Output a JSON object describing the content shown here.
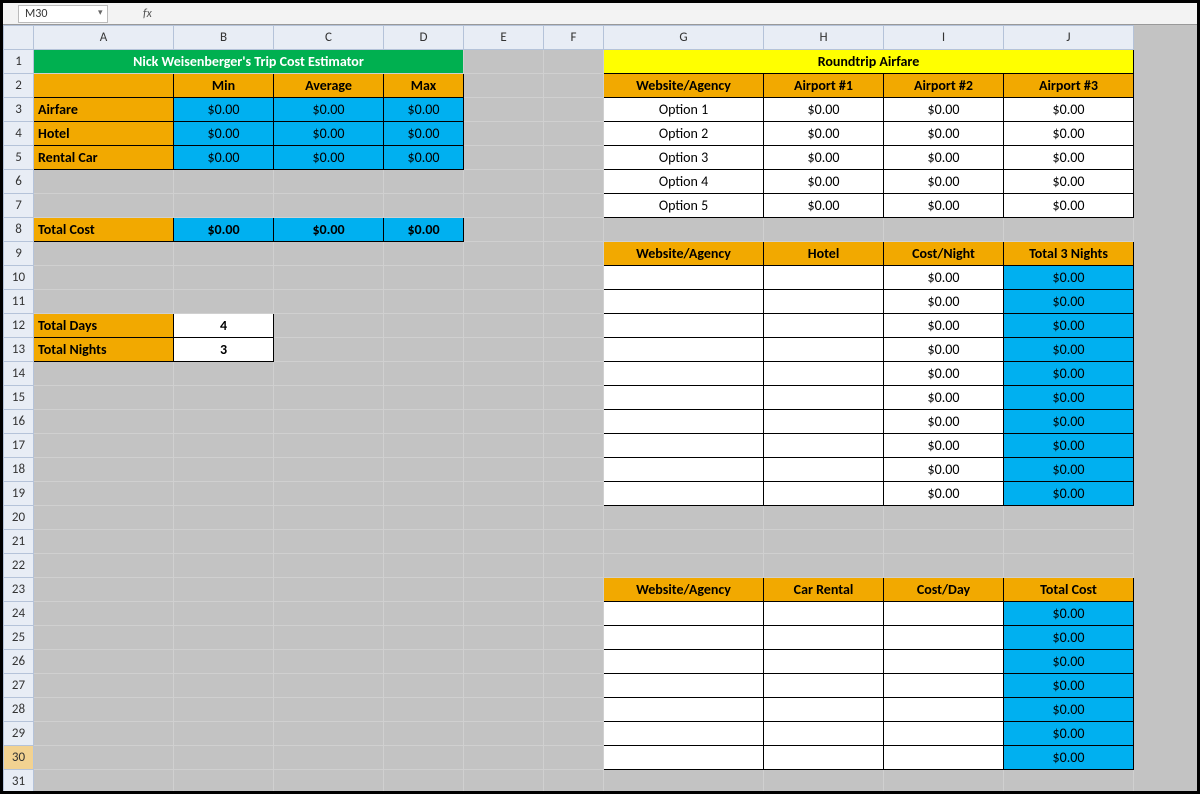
{
  "namebox": "M30",
  "fx_label": "fx",
  "columns": [
    "A",
    "B",
    "C",
    "D",
    "E",
    "F",
    "G",
    "H",
    "I",
    "J"
  ],
  "rows": [
    "1",
    "2",
    "3",
    "4",
    "5",
    "6",
    "7",
    "8",
    "9",
    "10",
    "11",
    "12",
    "13",
    "14",
    "15",
    "16",
    "17",
    "18",
    "19",
    "20",
    "21",
    "22",
    "23",
    "24",
    "25",
    "26",
    "27",
    "28",
    "29",
    "30",
    "31"
  ],
  "left": {
    "title": "Nick Weisenberger's Trip Cost Estimator",
    "headers": {
      "min": "Min",
      "avg": "Average",
      "max": "Max"
    },
    "rows": {
      "airfare": {
        "label": "Airfare",
        "min": "$0.00",
        "avg": "$0.00",
        "max": "$0.00"
      },
      "hotel": {
        "label": "Hotel",
        "min": "$0.00",
        "avg": "$0.00",
        "max": "$0.00"
      },
      "rental": {
        "label": "Rental Car",
        "min": "$0.00",
        "avg": "$0.00",
        "max": "$0.00"
      }
    },
    "total": {
      "label": "Total Cost",
      "min": "$0.00",
      "avg": "$0.00",
      "max": "$0.00"
    },
    "days": {
      "label": "Total Days",
      "value": "4"
    },
    "nights": {
      "label": "Total Nights",
      "value": "3"
    }
  },
  "airfare": {
    "title": "Roundtrip Airfare",
    "headers": {
      "site": "Website/Agency",
      "a1": "Airport #1",
      "a2": "Airport #2",
      "a3": "Airport #3"
    },
    "rows": [
      {
        "site": "Option 1",
        "a1": "$0.00",
        "a2": "$0.00",
        "a3": "$0.00"
      },
      {
        "site": "Option 2",
        "a1": "$0.00",
        "a2": "$0.00",
        "a3": "$0.00"
      },
      {
        "site": "Option 3",
        "a1": "$0.00",
        "a2": "$0.00",
        "a3": "$0.00"
      },
      {
        "site": "Option 4",
        "a1": "$0.00",
        "a2": "$0.00",
        "a3": "$0.00"
      },
      {
        "site": "Option 5",
        "a1": "$0.00",
        "a2": "$0.00",
        "a3": "$0.00"
      }
    ]
  },
  "lodging": {
    "headers": {
      "site": "Website/Agency",
      "hotel": "Hotel",
      "costnight": "Cost/Night",
      "total": "Total 3 Nights"
    },
    "rows": [
      {
        "cost": "$0.00",
        "total": "$0.00"
      },
      {
        "cost": "$0.00",
        "total": "$0.00"
      },
      {
        "cost": "$0.00",
        "total": "$0.00"
      },
      {
        "cost": "$0.00",
        "total": "$0.00"
      },
      {
        "cost": "$0.00",
        "total": "$0.00"
      },
      {
        "cost": "$0.00",
        "total": "$0.00"
      },
      {
        "cost": "$0.00",
        "total": "$0.00"
      },
      {
        "cost": "$0.00",
        "total": "$0.00"
      },
      {
        "cost": "$0.00",
        "total": "$0.00"
      },
      {
        "cost": "$0.00",
        "total": "$0.00"
      }
    ]
  },
  "car": {
    "headers": {
      "site": "Website/Agency",
      "car": "Car Rental",
      "costday": "Cost/Day",
      "total": "Total Cost"
    },
    "rows": [
      {
        "total": "$0.00"
      },
      {
        "total": "$0.00"
      },
      {
        "total": "$0.00"
      },
      {
        "total": "$0.00"
      },
      {
        "total": "$0.00"
      },
      {
        "total": "$0.00"
      },
      {
        "total": "$0.00"
      }
    ]
  }
}
